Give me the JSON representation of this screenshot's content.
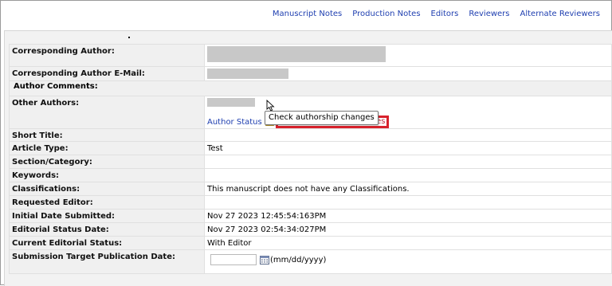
{
  "nav": {
    "links": [
      "Manuscript Notes",
      "Production Notes",
      "Editors",
      "Reviewers",
      "Alternate Reviewers"
    ]
  },
  "details": {
    "corresponding_author_label": "Corresponding Author:",
    "corresponding_email_label": "Corresponding Author E-Mail:",
    "author_comments_label": "Author Comments:",
    "other_authors_label": "Other Authors:",
    "author_status_link": "Author Status",
    "check_authorship_link": "Check authorship changes",
    "short_title_label": "Short Title:",
    "article_type_label": "Article Type:",
    "article_type_value": "Test",
    "section_label": "Section/Category:",
    "keywords_label": "Keywords:",
    "classifications_label": "Classifications:",
    "classifications_value": "This manuscript does not have any Classifications.",
    "requested_editor_label": "Requested Editor:",
    "initial_date_label": "Initial Date Submitted:",
    "initial_date_value": "Nov 27 2023 12:45:54:163PM",
    "editorial_status_date_label": "Editorial Status Date:",
    "editorial_status_date_value": "Nov 27 2023 02:54:34:027PM",
    "current_status_label": "Current Editorial Status:",
    "current_status_value": "With Editor",
    "target_date_label": "Submission Target Publication Date:",
    "target_date_value": "",
    "target_date_format": "(mm/dd/yyyy)"
  },
  "tooltip": {
    "text": "Check authorship changes"
  },
  "icons": {
    "warning": "warning-icon",
    "calendar": "calendar-icon",
    "cursor": "mouse-pointer-icon"
  },
  "colors": {
    "link": "#1f3fb0",
    "highlight_border": "#d8222c",
    "highlight_text": "#c0283a",
    "label_bg": "#f0f0f0"
  }
}
